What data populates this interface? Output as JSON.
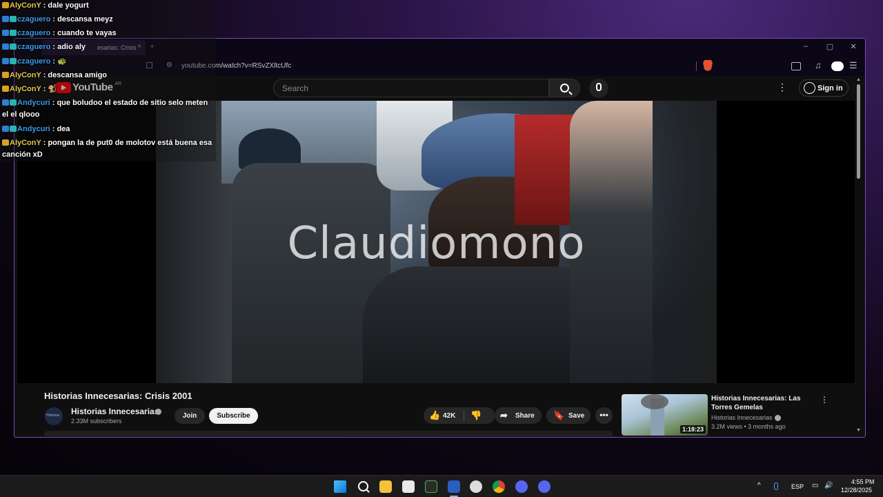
{
  "browser": {
    "tab_title": "esarias: Crisis",
    "tab_close": "×",
    "new_tab": "+",
    "url": "youtube.com/watch?v=RSvZXltcUfc",
    "window_controls": [
      "–",
      "▢",
      "✕"
    ]
  },
  "youtube": {
    "wordmark": "YouTube",
    "region": "AR",
    "search_placeholder": "Search",
    "sign_in": "Sign in",
    "more_icon": "⋮"
  },
  "video": {
    "watermark": "Claudiomono",
    "title": "Historias Innecesarias: Crisis 2001",
    "channel": {
      "name": "Historias Innecesarias",
      "subscribers": "2.33M subscribers",
      "avatar_text": "Historias"
    },
    "join_label": "Join",
    "subscribe_label": "Subscribe",
    "likes": "42K",
    "share_label": "Share",
    "save_label": "Save",
    "more": "•••"
  },
  "recommendation": {
    "title": "Historias Innecesarias: Las Torres Gemelas",
    "channel": "Historias Innecesarias",
    "meta": "3.2M views • 3 months ago",
    "duration": "1:18:23"
  },
  "chat": [
    {
      "user": "AlyConY",
      "text": " : dale yogurt",
      "user_color": "user-y",
      "badges": [
        "b-gold"
      ]
    },
    {
      "user": "czaguero",
      "text": " : descansa meyz",
      "user_color": "user-b",
      "badges": [
        "b-blue",
        "b-teal"
      ]
    },
    {
      "user": "czaguero",
      "text": " : cuando te vayas",
      "user_color": "user-b",
      "badges": [
        "b-blue",
        "b-teal"
      ]
    },
    {
      "user": "czaguero",
      "text": " : adio aly",
      "user_color": "user-b",
      "badges": [
        "b-blue",
        "b-teal"
      ]
    },
    {
      "user": "czaguero",
      "text": " : 🐢",
      "user_color": "user-b",
      "badges": [
        "b-blue",
        "b-teal"
      ]
    },
    {
      "user": "AlyConY",
      "text": " : descansa amigo",
      "user_color": "user-y",
      "badges": [
        "b-gold"
      ]
    },
    {
      "user": "AlyConY",
      "text": " : 🐒",
      "user_color": "user-y",
      "badges": [
        "b-gold"
      ]
    },
    {
      "user": "Andycuri",
      "text": " : que boludoo el estado de sitio selo meten el el qlooo",
      "user_color": "user-b",
      "badges": [
        "b-blue",
        "b-teal"
      ]
    },
    {
      "user": "Andycuri",
      "text": " : dea",
      "user_color": "user-b",
      "badges": [
        "b-blue",
        "b-teal"
      ]
    },
    {
      "user": "AlyConY",
      "text": " : pongan la de put0 de molotov está buena esa canción xD",
      "user_color": "user-y",
      "badges": [
        "b-gold"
      ]
    }
  ],
  "taskbar": {
    "tray_chevron": "^",
    "language": "ESP",
    "time": "4:55 PM",
    "date": "12/28/2025"
  }
}
